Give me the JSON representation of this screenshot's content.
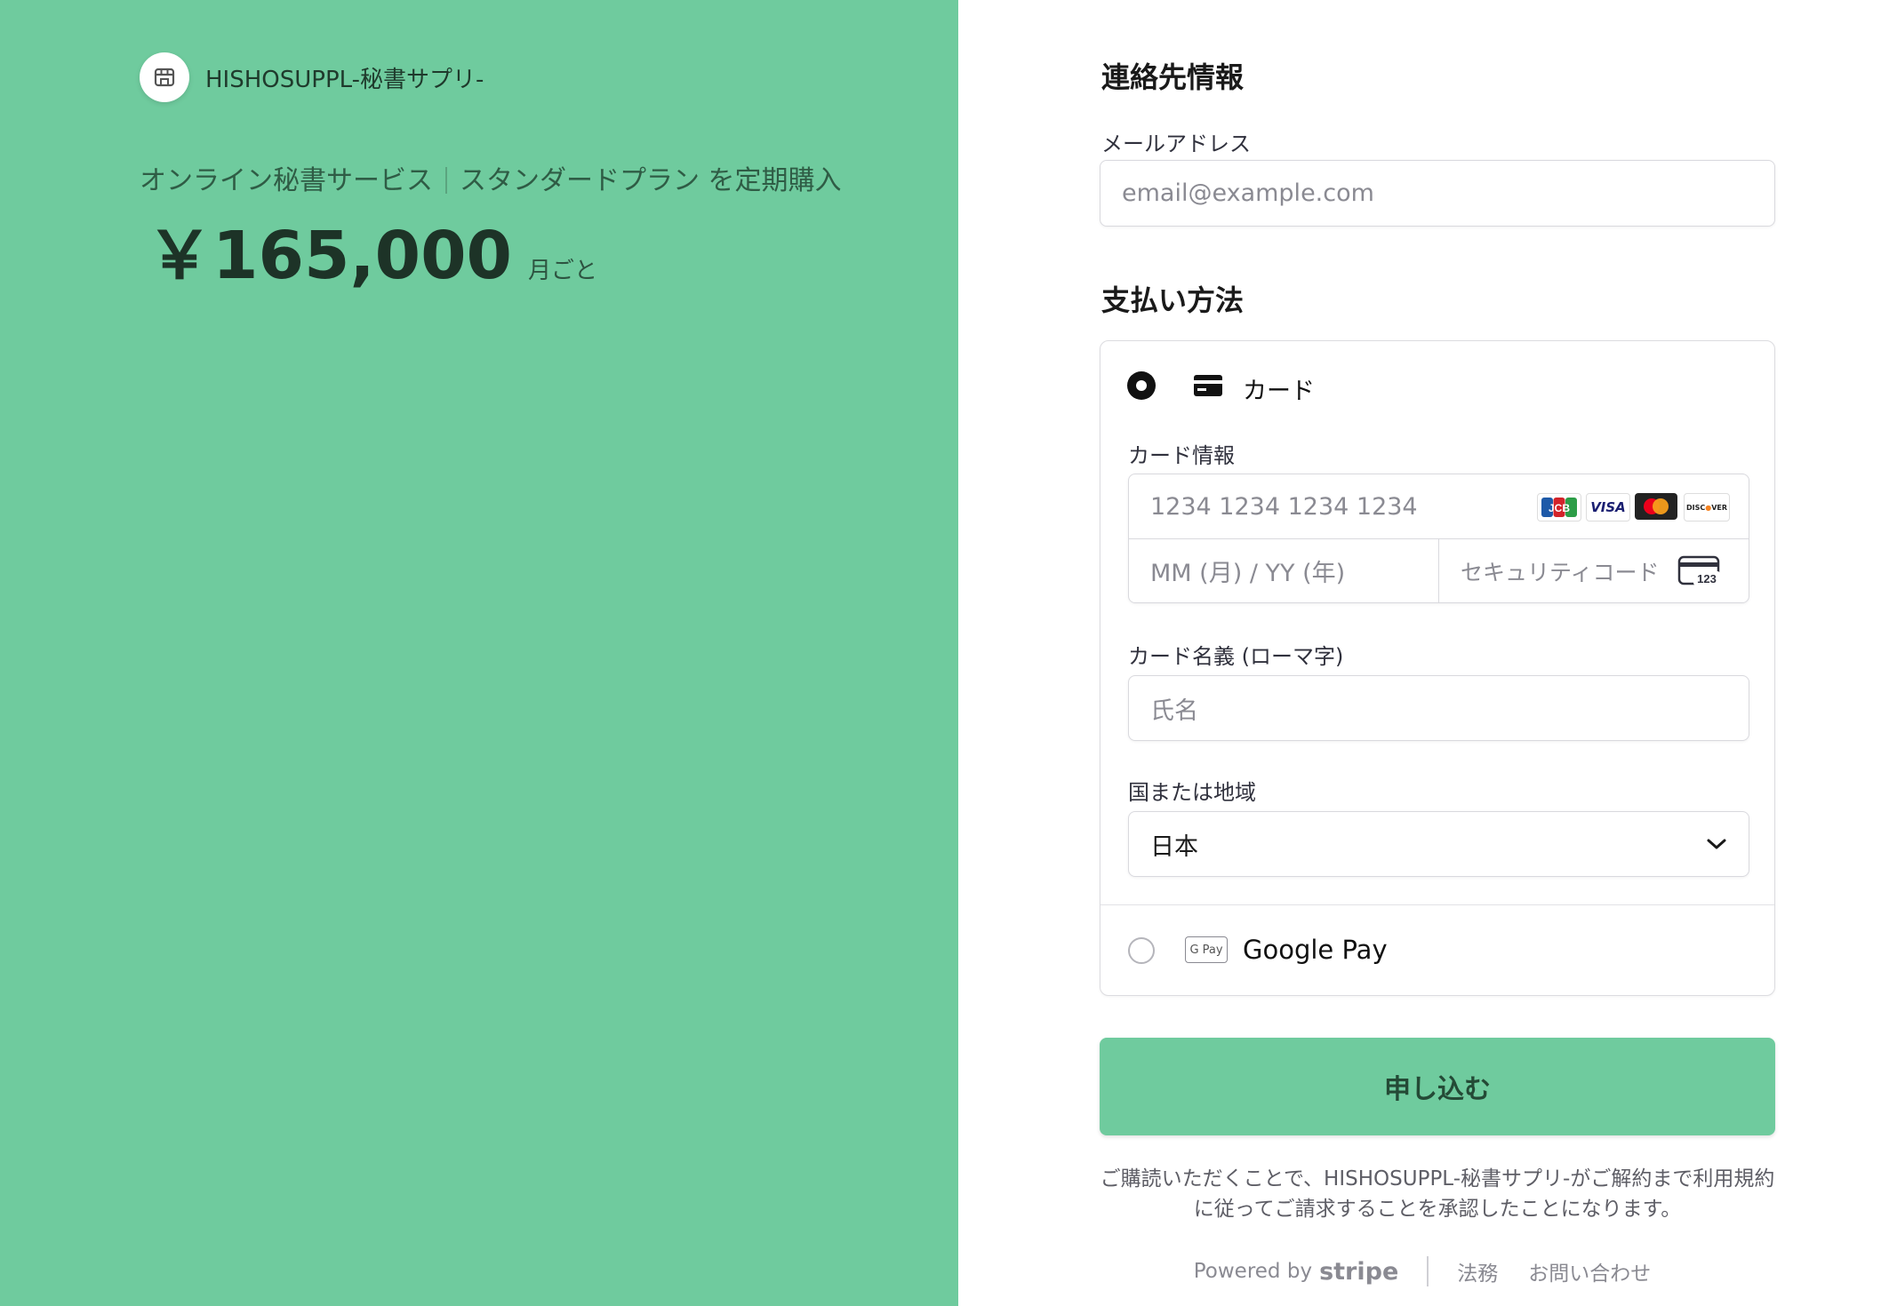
{
  "merchant": {
    "name": "HISHOSUPPL-秘書サプリ-"
  },
  "product": {
    "name": "オンライン秘書サービス",
    "plan": "スタンダードプラン を定期購入",
    "price": "￥165,000",
    "period": "月ごと"
  },
  "contact": {
    "title": "連絡先情報",
    "email_label": "メールアドレス",
    "email_placeholder": "email@example.com"
  },
  "payment": {
    "title": "支払い方法",
    "card_option_label": "カード",
    "card_info_label": "カード情報",
    "card_number_placeholder": "1234 1234 1234 1234",
    "expiry_placeholder": "MM (月) / YY (年)",
    "cvc_placeholder": "セキュリティコード",
    "cvc_icon_text": "123",
    "brands": [
      "JCB",
      "VISA",
      "Mastercard",
      "DISCOVER"
    ],
    "name_label": "カード名義 (ローマ字)",
    "name_placeholder": "氏名",
    "country_label": "国または地域",
    "country_value": "日本",
    "gpay_badge": "G Pay",
    "gpay_label": "Google Pay"
  },
  "submit": {
    "label": "申し込む"
  },
  "legal": {
    "line1": "ご購読いただくことで、HISHOSUPPL-秘書サプリ-がご解約まで利用規約",
    "line2": "に従ってご請求することを承認したことになります。"
  },
  "footer": {
    "powered_by": "Powered by",
    "stripe": "stripe",
    "terms": "法務",
    "contact": "お問い合わせ"
  },
  "colors": {
    "brand_green": "#6fcb9e",
    "text_dark": "#1a1a1a"
  }
}
